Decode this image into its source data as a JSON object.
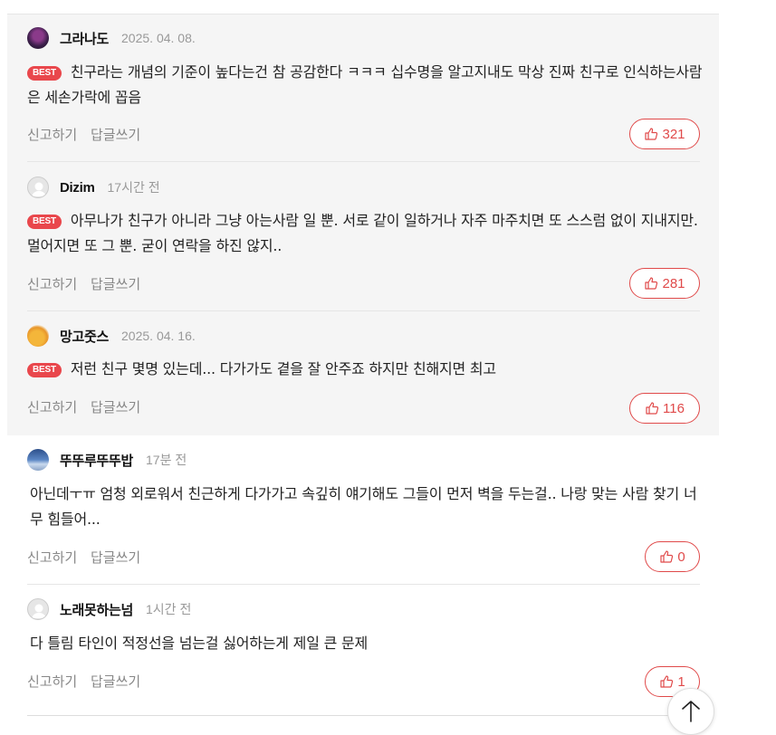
{
  "actions": {
    "report": "신고하기",
    "reply": "답글쓰기"
  },
  "best_label": "BEST",
  "icons": {
    "like": "thumbs-up-icon",
    "top": "arrow-up-icon"
  },
  "colors": {
    "accent": "#e04a4a",
    "best_bg": "#e9474c"
  },
  "comments": [
    {
      "nick": "그라나도",
      "time": "2025. 04. 08.",
      "best": true,
      "text": "친구라는 개념의 기준이 높다는건 참 공감한다 ㅋㅋㅋ 십수명을 알고지내도 막상 진짜 친구로 인식하는사람은 세손가락에 꼽음",
      "likes": "321",
      "avatar": "dark-photo"
    },
    {
      "nick": "Dizim",
      "time": "17시간 전",
      "best": true,
      "text": "아무나가 친구가 아니라 그냥 아는사람 일 뿐. 서로 같이 일하거나 자주 마주치면 또 스스럼 없이 지내지만. 멀어지면 또 그 뿐. 굳이 연락을 하진 않지..",
      "likes": "281",
      "avatar": "default"
    },
    {
      "nick": "망고줏스",
      "time": "2025. 04. 16.",
      "best": true,
      "text": "저런 친구 몇명 있는데... 다가가도 곁을 잘 안주죠 하지만 친해지면 최고",
      "likes": "116",
      "avatar": "yellow"
    },
    {
      "nick": "뚜뚜루뚜뚜밥",
      "time": "17분 전",
      "best": false,
      "text": "아닌데ㅜㅠ 엄청 외로워서 친근하게 다가가고 속깊히 얘기해도 그들이 먼저 벽을 두는걸.. 나랑 맞는 사람 찾기 너무 힘들어...",
      "likes": "0",
      "avatar": "blue-sky"
    },
    {
      "nick": "노래못하는넘",
      "time": "1시간 전",
      "best": false,
      "text": "다 틀림 타인이 적정선을 넘는걸 싫어하는게 제일 큰 문제",
      "likes": "1",
      "avatar": "default"
    }
  ]
}
